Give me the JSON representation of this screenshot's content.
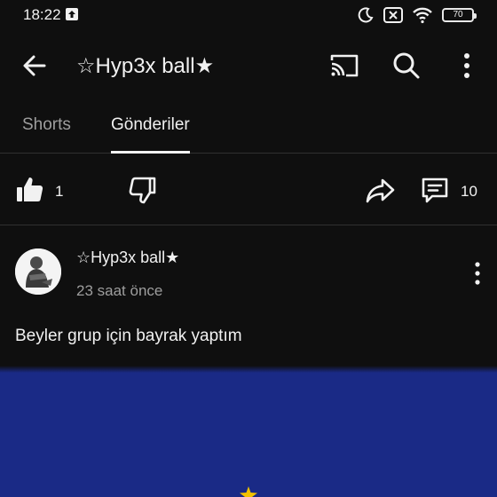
{
  "status_bar": {
    "time": "18:22",
    "battery": "70"
  },
  "header": {
    "title": "☆Hyp3x ball★"
  },
  "tabs": [
    {
      "label": "Shorts",
      "active": false
    },
    {
      "label": "Gönderiler",
      "active": true
    }
  ],
  "actions": {
    "like_count": "1",
    "comment_count": "10"
  },
  "post": {
    "author": "☆Hyp3x ball★",
    "time": "23 saat önce",
    "text": "Beyler grup için bayrak yaptım"
  },
  "colors": {
    "background": "#0f0f0f",
    "text_primary": "#f1f1f1",
    "text_secondary": "#9e9e9e",
    "divider": "#303030",
    "flag_blue": "#1a2a86",
    "flag_star": "#f2c200"
  },
  "icons": [
    "upload-notification-icon",
    "moon-icon",
    "no-sim-icon",
    "wifi-icon",
    "battery-icon",
    "back-arrow-icon",
    "cast-icon",
    "search-icon",
    "more-vert-icon",
    "thumb-up-icon",
    "thumb-down-icon",
    "share-icon",
    "comment-icon"
  ]
}
